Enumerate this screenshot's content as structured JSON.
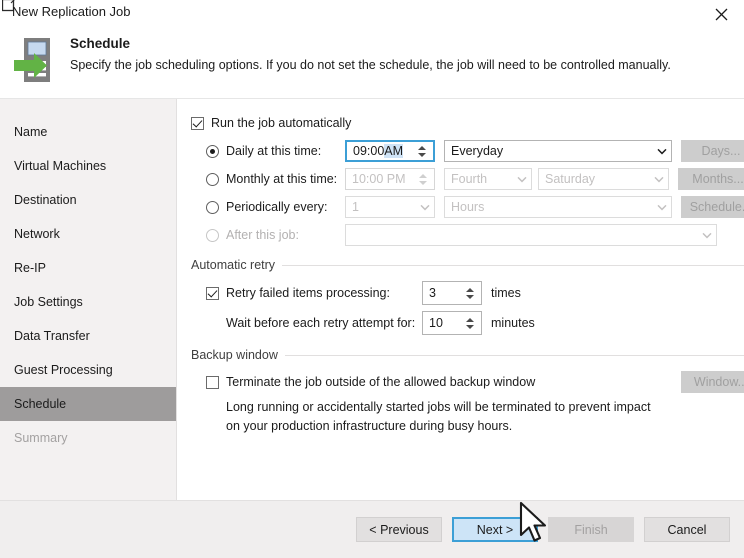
{
  "window": {
    "title": "New Replication Job",
    "close_icon": "close-icon",
    "app_icon": "window-icon"
  },
  "header": {
    "icon": "replication-server-arrow-icon",
    "title": "Schedule",
    "subtitle": "Specify the job scheduling options. If you do not set the schedule, the job will need to be controlled manually."
  },
  "sidebar": {
    "items": [
      {
        "label": "Name",
        "state": "normal"
      },
      {
        "label": "Virtual Machines",
        "state": "normal"
      },
      {
        "label": "Destination",
        "state": "normal"
      },
      {
        "label": "Network",
        "state": "normal"
      },
      {
        "label": "Re-IP",
        "state": "normal"
      },
      {
        "label": "Job Settings",
        "state": "normal"
      },
      {
        "label": "Data Transfer",
        "state": "normal"
      },
      {
        "label": "Guest Processing",
        "state": "normal"
      },
      {
        "label": "Schedule",
        "state": "active"
      },
      {
        "label": "Summary",
        "state": "disabled"
      }
    ]
  },
  "schedule": {
    "run_automatically": {
      "label": "Run the job automatically",
      "checked": true
    },
    "daily": {
      "label": "Daily at this time:",
      "selected": true,
      "time_prefix": "09:00 ",
      "time_meridiem": "AM",
      "period": "Everyday",
      "button": "Days..."
    },
    "monthly": {
      "label": "Monthly at this time:",
      "selected": false,
      "time": "10:00 PM",
      "ordinal": "Fourth",
      "weekday": "Saturday",
      "button": "Months..."
    },
    "periodically": {
      "label": "Periodically every:",
      "selected": false,
      "count": "1",
      "unit": "Hours",
      "button": "Schedule..."
    },
    "after_job": {
      "label": "After this job:",
      "selected": false,
      "value": ""
    }
  },
  "retry": {
    "group_title": "Automatic retry",
    "retry_failed": {
      "label": "Retry failed items processing:",
      "checked": true
    },
    "times_value": "3",
    "times_unit": "times",
    "wait_label": "Wait before each retry attempt for:",
    "wait_value": "10",
    "wait_unit": "minutes"
  },
  "backup_window": {
    "group_title": "Backup window",
    "terminate": {
      "label": "Terminate the job outside of the allowed backup window",
      "checked": false
    },
    "description_line1": "Long running or accidentally started jobs will be terminated to prevent impact",
    "description_line2": "on your production infrastructure during busy hours.",
    "button": "Window..."
  },
  "footer": {
    "previous": "< Previous",
    "next": "Next >",
    "finish": "Finish",
    "cancel": "Cancel"
  },
  "colors": {
    "accent": "#3c9fd6",
    "accent_fill": "#cde4f7",
    "selection": "#cfe3f6",
    "sidebar_bg": "#f3f1f1",
    "sidebar_active": "#9e9c9c",
    "icon_green": "#62b345",
    "icon_gray": "#7e7e7e"
  }
}
